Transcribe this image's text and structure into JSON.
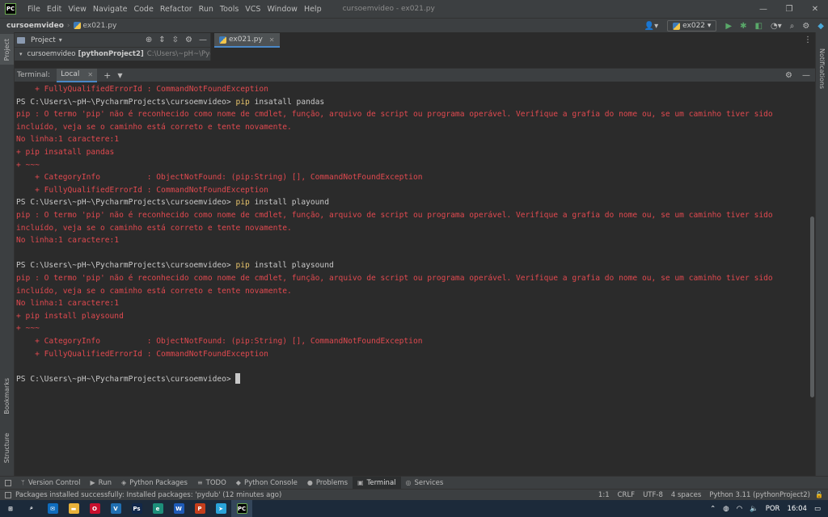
{
  "titlebar": {
    "logo": "PC",
    "menu": [
      "File",
      "Edit",
      "View",
      "Navigate",
      "Code",
      "Refactor",
      "Run",
      "Tools",
      "VCS",
      "Window",
      "Help"
    ],
    "title": "cursoemvideo - ex021.py",
    "buttons": [
      "—",
      "❐",
      "✕"
    ]
  },
  "navbar": {
    "project": "cursoemvideo",
    "file": "ex021.py",
    "run_config": "ex022",
    "icons": [
      "user-icon",
      "run-icon",
      "debug-icon",
      "coverage-icon",
      "profile-icon",
      "search-icon",
      "settings-icon",
      "plugin-icon"
    ]
  },
  "left_strip": {
    "project": "Project",
    "bookmarks": "Bookmarks",
    "structure": "Structure"
  },
  "right_strip": {
    "notifications": "Notifications"
  },
  "project_panel": {
    "header": "Project",
    "root_name": "cursoemvideo",
    "root_bold": "[pythonProject2]",
    "root_path": "C:\\Users\\~pH~\\Pycharm"
  },
  "editor": {
    "tab": "ex021.py"
  },
  "terminal": {
    "label": "Terminal:",
    "tab": "Local",
    "lines": [
      {
        "type": "err",
        "text": "    + FullyQualifiedErrorId : CommandNotFoundException"
      },
      {
        "type": "ps",
        "prompt": "PS C:\\Users\\~pH~\\PycharmProjects\\cursoemvideo> ",
        "cmd": "pip",
        "args": " insatall pandas"
      },
      {
        "type": "err",
        "text": "pip : O termo 'pip' não é reconhecido como nome de cmdlet, função, arquivo de script ou programa operável. Verifique a grafia do nome ou, se um caminho tiver sido"
      },
      {
        "type": "err",
        "text": "incluído, veja se o caminho está correto e tente novamente."
      },
      {
        "type": "err",
        "text": "No linha:1 caractere:1"
      },
      {
        "type": "err",
        "text": "+ pip insatall pandas"
      },
      {
        "type": "err",
        "text": "+ ~~~"
      },
      {
        "type": "err",
        "text": "    + CategoryInfo          : ObjectNotFound: (pip:String) [], CommandNotFoundException"
      },
      {
        "type": "err",
        "text": "    + FullyQualifiedErrorId : CommandNotFoundException"
      },
      {
        "type": "ps",
        "prompt": "PS C:\\Users\\~pH~\\PycharmProjects\\cursoemvideo> ",
        "cmd": "pip",
        "args": " install playound"
      },
      {
        "type": "err",
        "text": "pip : O termo 'pip' não é reconhecido como nome de cmdlet, função, arquivo de script ou programa operável. Verifique a grafia do nome ou, se um caminho tiver sido"
      },
      {
        "type": "err",
        "text": "incluído, veja se o caminho está correto e tente novamente."
      },
      {
        "type": "err",
        "text": "No linha:1 caractere:1"
      },
      {
        "type": "blank",
        "text": ""
      },
      {
        "type": "ps",
        "prompt": "PS C:\\Users\\~pH~\\PycharmProjects\\cursoemvideo> ",
        "cmd": "pip",
        "args": " install playsound"
      },
      {
        "type": "err",
        "text": "pip : O termo 'pip' não é reconhecido como nome de cmdlet, função, arquivo de script ou programa operável. Verifique a grafia do nome ou, se um caminho tiver sido"
      },
      {
        "type": "err",
        "text": "incluído, veja se o caminho está correto e tente novamente."
      },
      {
        "type": "err",
        "text": "No linha:1 caractere:1"
      },
      {
        "type": "err",
        "text": "+ pip install playsound"
      },
      {
        "type": "err",
        "text": "+ ~~~"
      },
      {
        "type": "err",
        "text": "    + CategoryInfo          : ObjectNotFound: (pip:String) [], CommandNotFoundException"
      },
      {
        "type": "err",
        "text": "    + FullyQualifiedErrorId : CommandNotFoundException"
      },
      {
        "type": "blank",
        "text": ""
      },
      {
        "type": "prompt",
        "prompt": "PS C:\\Users\\~pH~\\PycharmProjects\\cursoemvideo> "
      }
    ]
  },
  "bottom_tabs": [
    {
      "label": "Version Control",
      "icon": "branch-icon",
      "glyph": "ᛘ"
    },
    {
      "label": "Run",
      "icon": "run-icon",
      "glyph": "▶"
    },
    {
      "label": "Python Packages",
      "icon": "packages-icon",
      "glyph": "◈"
    },
    {
      "label": "TODO",
      "icon": "todo-icon",
      "glyph": "≡"
    },
    {
      "label": "Python Console",
      "icon": "python-console-icon",
      "glyph": "◆"
    },
    {
      "label": "Problems",
      "icon": "problems-icon",
      "glyph": "●"
    },
    {
      "label": "Terminal",
      "icon": "terminal-icon",
      "glyph": "▣",
      "active": true
    },
    {
      "label": "Services",
      "icon": "services-icon",
      "glyph": "◎"
    }
  ],
  "statusbar": {
    "message": "Packages installed successfully: Installed packages: 'pydub' (12 minutes ago)",
    "position": "1:1",
    "line_sep": "CRLF",
    "encoding": "UTF-8",
    "indent": "4 spaces",
    "interpreter": "Python 3.11 (pythonProject2)"
  },
  "taskbar": {
    "apps": [
      {
        "name": "windows-start-icon",
        "glyph": "⊞",
        "color": "#1c2a3a"
      },
      {
        "name": "search-icon",
        "glyph": "⌕",
        "color": "#1c2a3a"
      },
      {
        "name": "mail-icon",
        "glyph": "✉",
        "color": "#0f6cbd"
      },
      {
        "name": "file-explorer-icon",
        "glyph": "▬",
        "color": "#e8b23a"
      },
      {
        "name": "opera-icon",
        "glyph": "O",
        "color": "#c8102e"
      },
      {
        "name": "vscode-icon",
        "glyph": "V",
        "color": "#1f6fb2"
      },
      {
        "name": "photoshop-icon",
        "glyph": "Ps",
        "color": "#12284a"
      },
      {
        "name": "edge-icon",
        "glyph": "e",
        "color": "#1d8f7a"
      },
      {
        "name": "word-icon",
        "glyph": "W",
        "color": "#1e5bb8"
      },
      {
        "name": "powerpoint-icon",
        "glyph": "P",
        "color": "#c43e1c"
      },
      {
        "name": "telegram-icon",
        "glyph": "➤",
        "color": "#2aa3d9"
      },
      {
        "name": "pycharm-icon",
        "glyph": "PC",
        "color": "#000000"
      }
    ],
    "lang": "POR",
    "time": "16:04"
  },
  "colors": {
    "error": "#e0494f",
    "command": "#e8c46b",
    "accent": "#4a88c7"
  }
}
